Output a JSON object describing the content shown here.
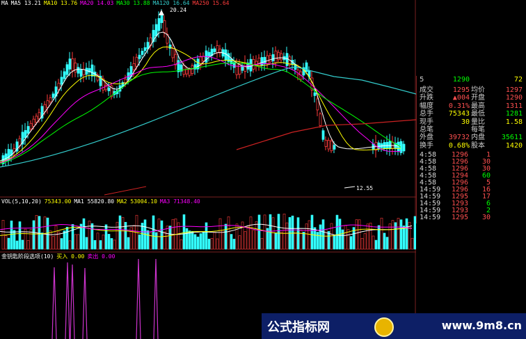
{
  "colors": {
    "up": "#ff3c3c",
    "down": "#33ffff",
    "ma5": "#ffffff",
    "ma10": "#ffff00",
    "ma20": "#ff00ff",
    "ma30": "#00ff00",
    "ma120": "#33cccc",
    "ma250": "#cc2222",
    "vol": "#bbbbbb",
    "volma1": "#ffffff",
    "volma2": "#ffff00",
    "volma3": "#ff00ff",
    "signal": "#cc33cc",
    "label": "#cfcfcf",
    "price_red": "#ff5050",
    "price_green": "#00ff00",
    "price_yellow": "#ffff00",
    "footer_bg": "#0d1f66"
  },
  "main_legend": [
    {
      "text": "MA",
      "color": "#ffffff"
    },
    {
      "text": "MA5 13.21",
      "color": "#ffffff"
    },
    {
      "text": "MA10 13.76",
      "color": "#ffff00"
    },
    {
      "text": "MA20 14.03",
      "color": "#ff00ff"
    },
    {
      "text": "MA30 13.88",
      "color": "#00ff00"
    },
    {
      "text": "MA120 16.64",
      "color": "#33cccc"
    },
    {
      "text": "MA250 15.64",
      "color": "#ff3c3c"
    }
  ],
  "price_annotations": {
    "high": "20.24",
    "low": "12.55"
  },
  "vol_legend": [
    {
      "text": "VOL(5,10,20)",
      "color": "#ffffff"
    },
    {
      "text": "75343.00",
      "color": "#ffff00"
    },
    {
      "text": "MA1 55820.80",
      "color": "#ffffff"
    },
    {
      "text": "MA2 53004.10",
      "color": "#ffff00"
    },
    {
      "text": "MA3 71348.40",
      "color": "#ff00ff"
    }
  ],
  "indicator_legend": [
    {
      "text": "金钥匙阶段选项(10)",
      "color": "#ffffff"
    },
    {
      "text": "买入 0.00",
      "color": "#ffff00"
    },
    {
      "text": "卖出 0.00",
      "color": "#ff00ff"
    }
  ],
  "quote": {
    "top_row": {
      "label": "5",
      "v1": "1290",
      "l2": "",
      "v2": "72"
    },
    "rows": [
      {
        "label": "成交",
        "v1": "1295",
        "c1": "#ff5050",
        "l2": "均价",
        "v2": "1297",
        "c2": "#ff5050"
      },
      {
        "label": "升跌",
        "v1": "▲004",
        "c1": "#ff5050",
        "l2": "开盘",
        "v2": "1290",
        "c2": "#ff5050"
      },
      {
        "label": "幅度",
        "v1": "0.31%",
        "c1": "#ff5050",
        "l2": "最高",
        "v2": "1311",
        "c2": "#ff5050"
      },
      {
        "label": "总手",
        "v1": "75343",
        "c1": "#ffff00",
        "l2": "最低",
        "v2": "1281",
        "c2": "#00ff00"
      },
      {
        "label": "现手",
        "v1": "30",
        "c1": "#ffff00",
        "l2": "量比",
        "v2": "1.58",
        "c2": "#ffff00"
      },
      {
        "label": "总笔",
        "v1": "",
        "c1": "#ffff00",
        "l2": "每笔",
        "v2": "",
        "c2": "#ffff00"
      },
      {
        "label": "外盘",
        "v1": "39732",
        "c1": "#ff5050",
        "l2": "内盘",
        "v2": "35611",
        "c2": "#00ff00"
      },
      {
        "label": "换手",
        "v1": "0.68%",
        "c1": "#ffff00",
        "l2": "股本",
        "v2": "1420",
        "c2": "#ffff00"
      }
    ],
    "trades": [
      {
        "time": "4:58",
        "price": "1296",
        "qty": "1",
        "dir": ""
      },
      {
        "time": "4:58",
        "price": "1296",
        "qty": "30",
        "dir": ""
      },
      {
        "time": "4:58",
        "price": "1296",
        "qty": "30",
        "dir": ""
      },
      {
        "time": "4:58",
        "price": "1294",
        "qty": "60",
        "dir": ""
      },
      {
        "time": "4:58",
        "price": "1296",
        "qty": "5",
        "dir": ""
      },
      {
        "time": "14:59",
        "price": "1296",
        "qty": "16",
        "dir": ""
      },
      {
        "time": "14:59",
        "price": "1295",
        "qty": "17",
        "dir": ""
      },
      {
        "time": "14:59",
        "price": "1293",
        "qty": "6",
        "dir": ""
      },
      {
        "time": "14:59",
        "price": "1293",
        "qty": "2",
        "dir": ""
      },
      {
        "time": "14:59",
        "price": "1295",
        "qty": "30",
        "dir": ""
      }
    ]
  },
  "footer": {
    "left": "公式指标网",
    "right": "www.9m8.cn"
  }
}
